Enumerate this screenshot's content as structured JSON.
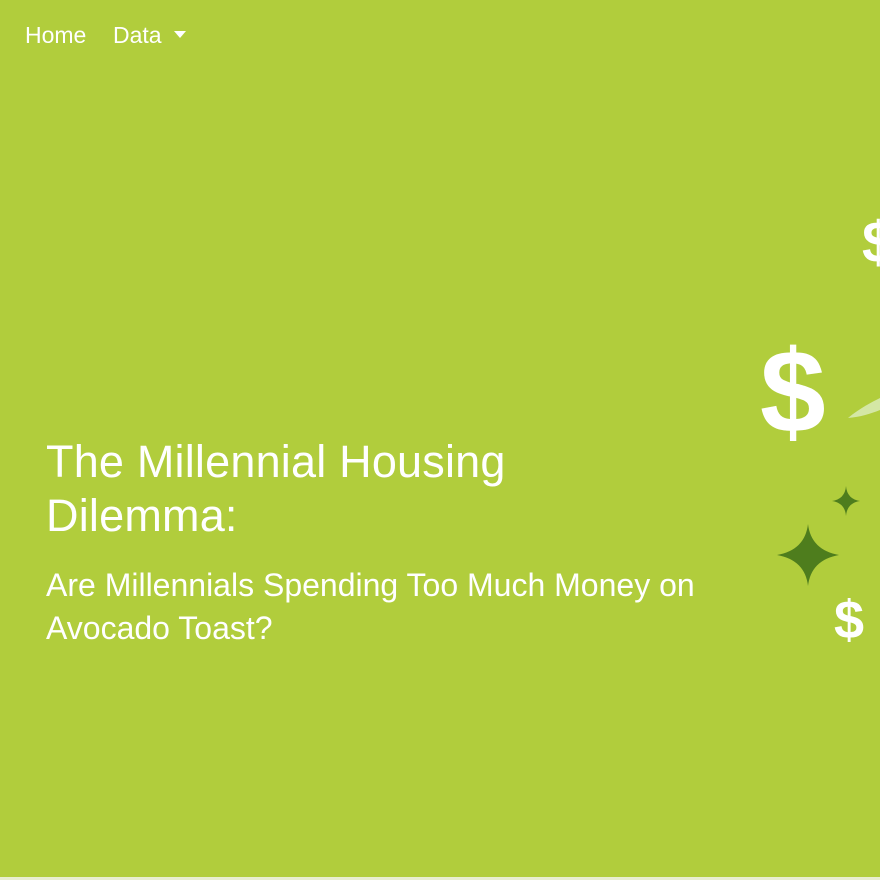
{
  "nav": {
    "home_label": "Home",
    "data_label": "Data"
  },
  "hero": {
    "title": "The Millennial Housing Dilemma:",
    "subtitle": "Are Millennials Spending Too Much Money on Avocado Toast?"
  },
  "decor": {
    "dollar_glyph": "$",
    "sparkle_color": "#4e7d1d",
    "background_color": "#b1cd3c"
  },
  "icons": [
    "caret-down-icon",
    "dollar-sign-icon",
    "sparkle-icon",
    "leaf-icon"
  ]
}
